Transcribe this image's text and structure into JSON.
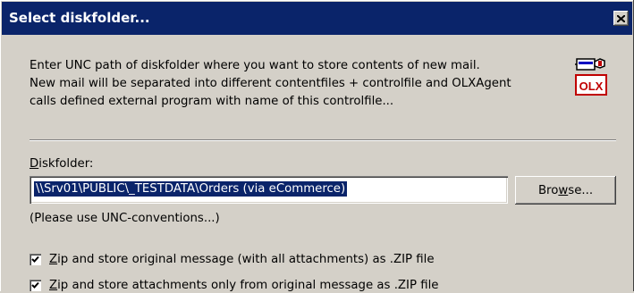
{
  "dialog": {
    "title": "Select diskfolder...",
    "intro_lines": [
      "Enter UNC path of diskfolder where you want to store contents of new mail.",
      "New mail will be separated into different contentfiles + controlfile and OLXAgent",
      "calls defined external program with name of this controlfile..."
    ],
    "icon_name": "olx-icon",
    "icon_text": "OLX",
    "close_icon": "close-icon"
  },
  "diskfolder": {
    "label_accel": "D",
    "label_rest": "iskfolder:",
    "value": "\\\\Srv01\\PUBLIC\\_TESTDATA\\Orders (via eCommerce)",
    "browse_accel": "w",
    "browse_before": "Bro",
    "browse_after": "se...",
    "hint": "(Please use UNC-conventions...)"
  },
  "options": [
    {
      "checked": true,
      "accel": "Z",
      "rest": "ip and store original message (with all attachments) as .ZIP file"
    },
    {
      "checked": true,
      "accel": "Z",
      "rest": "ip and store attachments only from original message as .ZIP file"
    }
  ],
  "colors": {
    "titlebar": "#0a246a",
    "face": "#d4d0c8",
    "selection": "#0a246a"
  }
}
